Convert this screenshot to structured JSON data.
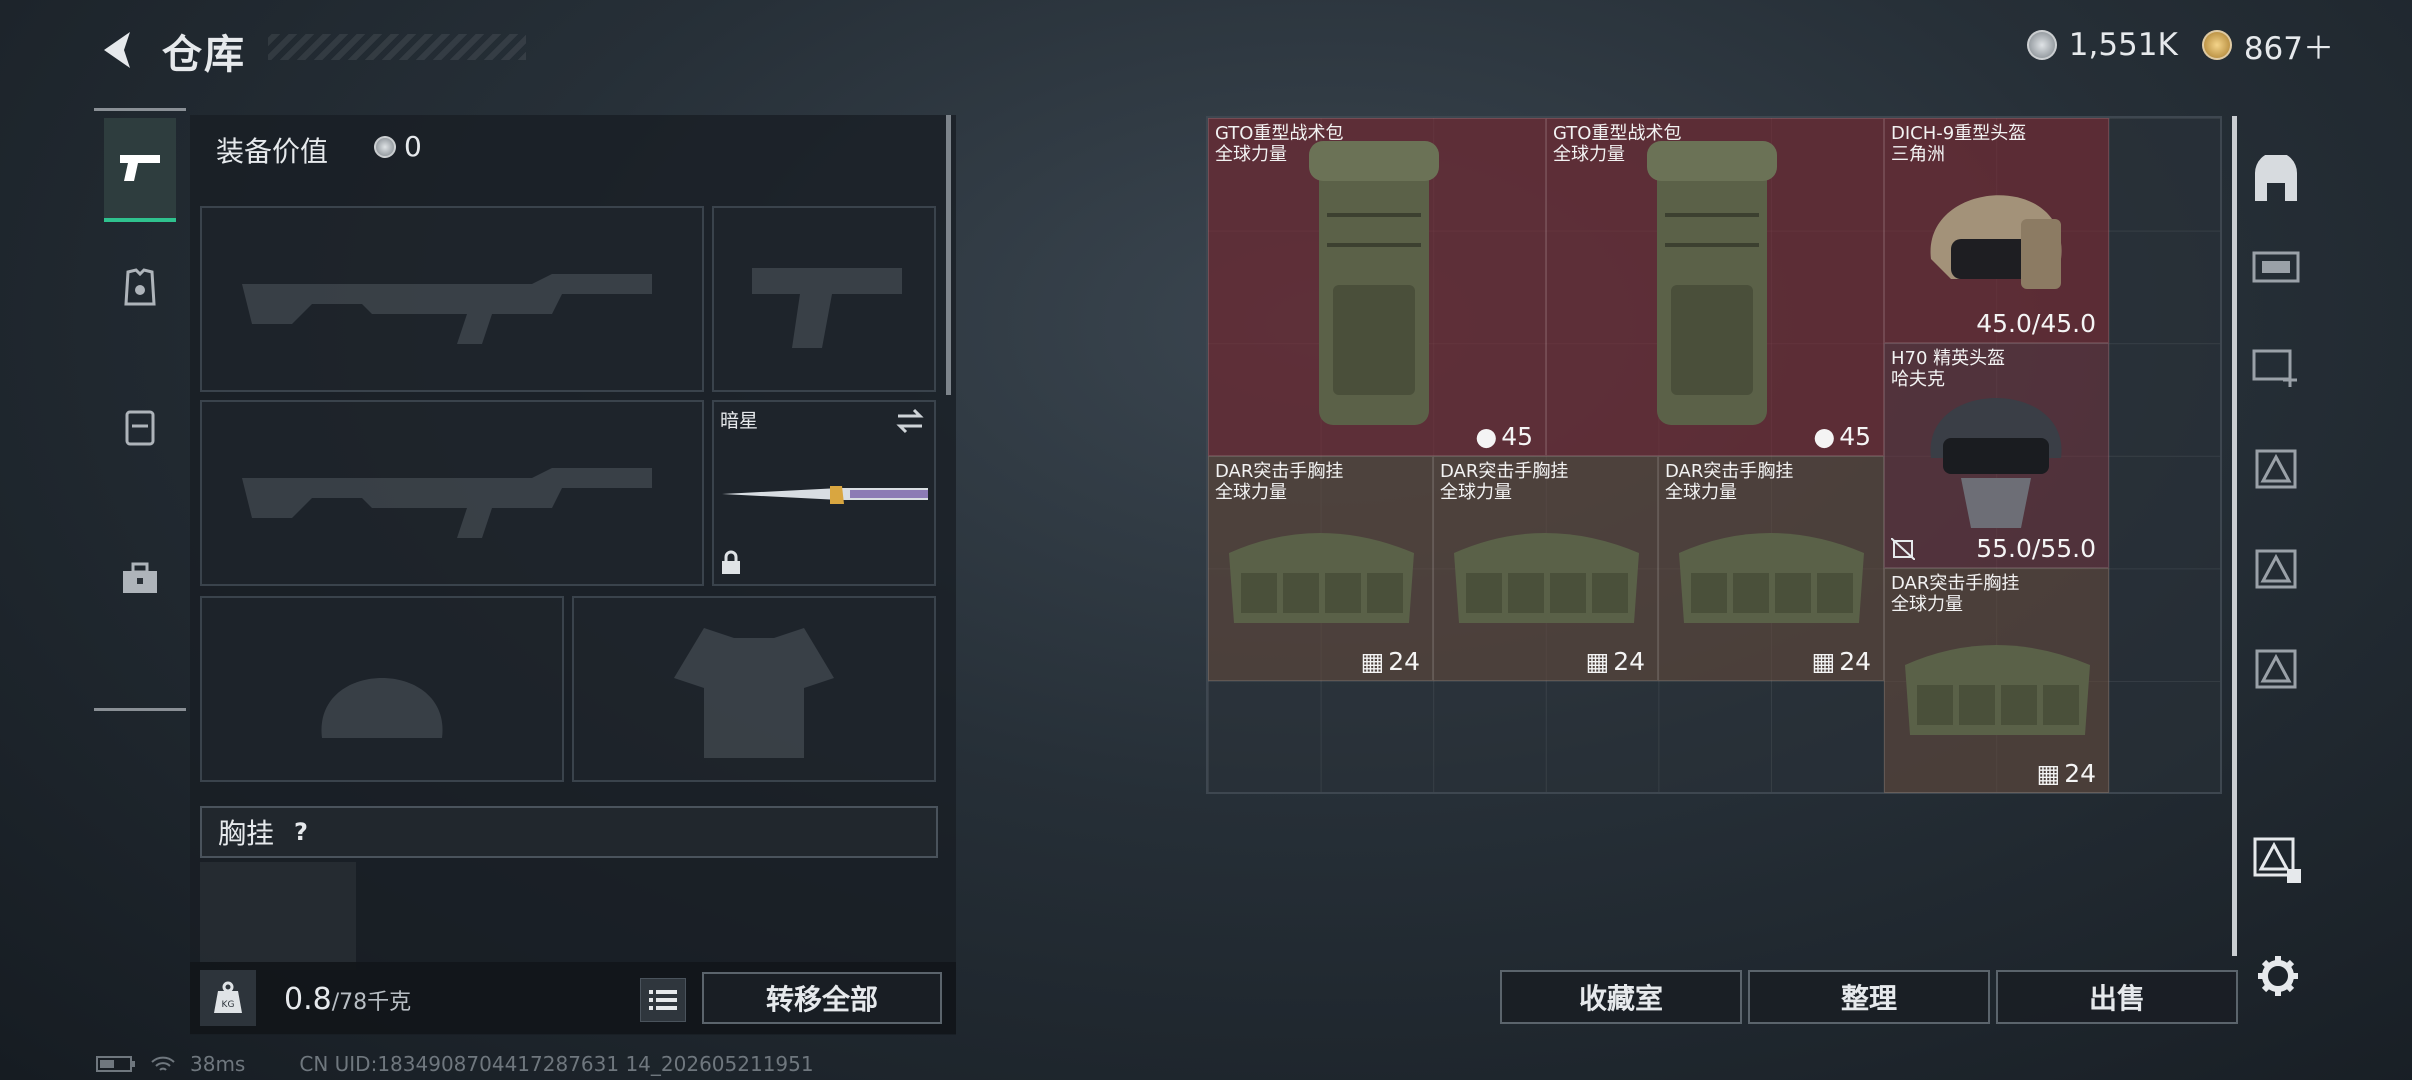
{
  "header": {
    "title": "仓库"
  },
  "currency": {
    "silver": "1,551K",
    "gold": "867＋"
  },
  "loadout": {
    "value_label": "装备价值",
    "value_amount": "0",
    "melee_name": "暗星",
    "vest_label": "胸挂",
    "vest_help": "?"
  },
  "weight": {
    "current": "0.8",
    "max": "/78千克",
    "kg_badge": "KG"
  },
  "buttons": {
    "transfer_all": "转移全部",
    "collection": "收藏室",
    "organize": "整理",
    "sell": "出售"
  },
  "stash_items": [
    {
      "name": "GTO重型战术包",
      "sub": "全球力量",
      "stat": "45",
      "icon": "backpack-capacity-icon"
    },
    {
      "name": "GTO重型战术包",
      "sub": "全球力量",
      "stat": "45",
      "icon": "backpack-capacity-icon"
    },
    {
      "name": "DICH-9重型头盔",
      "sub": "三角洲",
      "stat": "45.0/45.0"
    },
    {
      "name": "H70 精英头盔",
      "sub": "哈夫克",
      "stat": "55.0/55.0"
    },
    {
      "name": "DAR突击手胸挂",
      "sub": "全球力量",
      "stat": "24",
      "icon": "vest-capacity-icon"
    },
    {
      "name": "DAR突击手胸挂",
      "sub": "全球力量",
      "stat": "24",
      "icon": "vest-capacity-icon"
    },
    {
      "name": "DAR突击手胸挂",
      "sub": "全球力量",
      "stat": "24",
      "icon": "vest-capacity-icon"
    },
    {
      "name": "DAR突击手胸挂",
      "sub": "全球力量",
      "stat": "24",
      "icon": "vest-capacity-icon"
    }
  ],
  "status_bar": {
    "ping": "38ms",
    "uid": "CN UID:1834908704417287631 14_202605211951"
  },
  "colors": {
    "accent_green": "#2fc28e",
    "rare_red": "#7a2a34",
    "item_brown": "#624a3c"
  }
}
